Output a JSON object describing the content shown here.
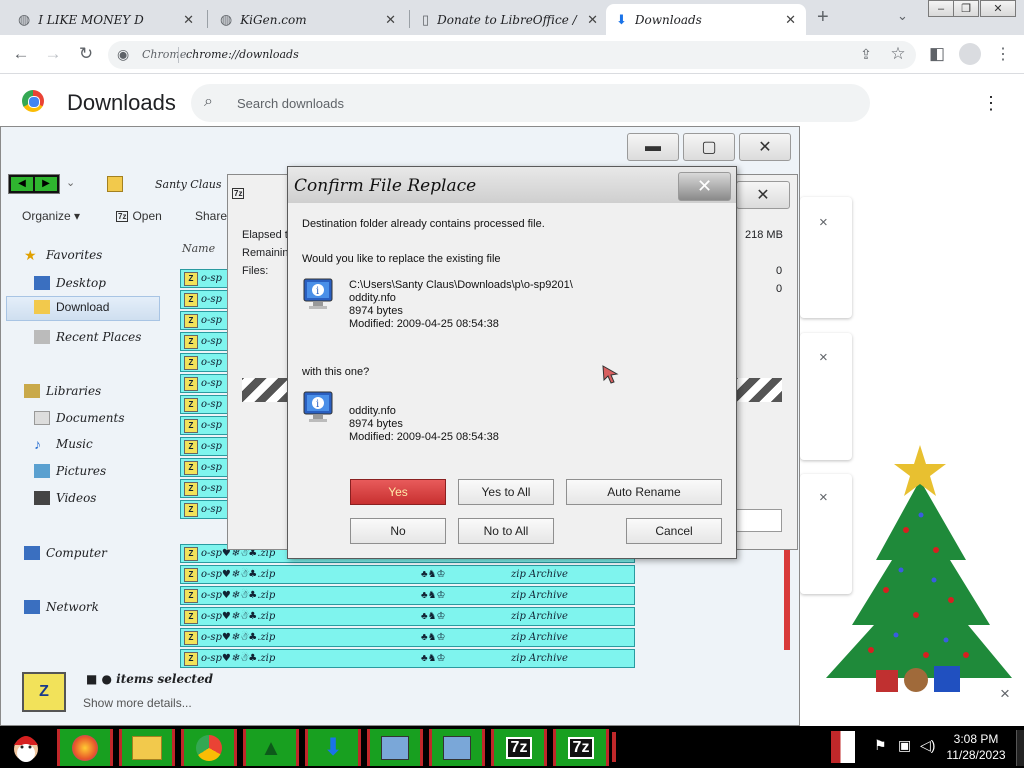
{
  "browser": {
    "tabs": [
      {
        "title": "I LIKE MONEY D",
        "active": false
      },
      {
        "title": "KiGen.com",
        "active": false
      },
      {
        "title": "Donate to LibreOffice / Lib",
        "active": false
      },
      {
        "title": "Downloads",
        "active": true
      }
    ],
    "new_tab_icon": "plus-icon",
    "address_site": "Chrome",
    "address_url": "chrome://downloads"
  },
  "downloads_page": {
    "title": "Downloads",
    "search_placeholder": "Search downloads",
    "close_glyph": "×"
  },
  "explorer": {
    "location_label": "Santy Claus",
    "toolbar": {
      "organize": "Organize",
      "open": "Open",
      "share": "Share"
    },
    "column_name": "Name",
    "nav": {
      "favorites": "Favorites",
      "desktop": "Desktop",
      "download": "Download",
      "recent_places": "Recent Places",
      "libraries": "Libraries",
      "documents": "Documents",
      "music": "Music",
      "pictures": "Pictures",
      "videos": "Videos",
      "computer": "Computer",
      "network": "Network"
    },
    "file_rows": [
      {
        "name": "o-sp",
        "type": "",
        "extra": ""
      },
      {
        "name": "o-sp",
        "type": "",
        "extra": ""
      },
      {
        "name": "o-sp",
        "type": "",
        "extra": ""
      },
      {
        "name": "o-sp",
        "type": "",
        "extra": ""
      },
      {
        "name": "o-sp",
        "type": "",
        "extra": ""
      },
      {
        "name": "o-sp",
        "type": "",
        "extra": ""
      },
      {
        "name": "o-sp",
        "type": "",
        "extra": ""
      },
      {
        "name": "o-sp",
        "type": "",
        "extra": ""
      },
      {
        "name": "o-sp",
        "type": "",
        "extra": ""
      },
      {
        "name": "o-sp",
        "type": "",
        "extra": ""
      },
      {
        "name": "o-sp",
        "type": "",
        "extra": ""
      },
      {
        "name": "o-sp",
        "type": "",
        "extra": ""
      },
      {
        "name": "o-sp♥❄☃♣.zip",
        "type": "",
        "extra": ""
      },
      {
        "name": "o-sp♥❄☃♣.zip",
        "type": "zip Archive",
        "extra": "♣♞♔"
      },
      {
        "name": "o-sp♥❄☃♣.zip",
        "type": "zip Archive",
        "extra": "♣♞♔"
      },
      {
        "name": "o-sp♥❄☃♣.zip",
        "type": "zip Archive",
        "extra": "♣♞♔"
      },
      {
        "name": "o-sp♥❄☃♣.zip",
        "type": "zip Archive",
        "extra": "♣♞♔"
      },
      {
        "name": "o-sp♥❄☃♣.zip",
        "type": "zip Archive",
        "extra": "♣♞♔"
      }
    ],
    "status_selected": "items selected",
    "show_more": "Show more details..."
  },
  "progress_dialog": {
    "elapsed": "Elapsed ti",
    "remaining": "Remaining",
    "files": "Files:",
    "size_value": "218 MB",
    "val1": "0",
    "val2": "0"
  },
  "confirm_dialog": {
    "title": "Confirm File Replace",
    "line_destination": "Destination folder already contains processed file.",
    "line_question": "Would you like to replace the existing file",
    "existing": {
      "path": "C:\\Users\\Santy Claus\\Downloads\\p\\o-sp9201\\",
      "name": "oddity.nfo",
      "size": "8974 bytes",
      "modified": "Modified: 2009-04-25 08:54:38"
    },
    "with_this": "with this one?",
    "new_file": {
      "name": "oddity.nfo",
      "size": "8974 bytes",
      "modified": "Modified: 2009-04-25 08:54:38"
    },
    "buttons": {
      "yes": "Yes",
      "yes_to_all": "Yes to All",
      "auto_rename": "Auto Rename",
      "no": "No",
      "no_to_all": "No to All",
      "cancel": "Cancel"
    }
  },
  "taskbar": {
    "apps": [
      "Firefox",
      "File Explorer",
      "Chrome",
      "Christmas Tree",
      "Downloads",
      "Network",
      "Network",
      "7z",
      "7z"
    ],
    "label_7z": "7z",
    "time": "3:08 PM",
    "date": "11/28/2023"
  },
  "colors": {
    "taskbar_bg": "#000000",
    "taskbar_button": "#18a020",
    "file_row": "#7ff4ee",
    "yes_button": "#d83c3c"
  }
}
